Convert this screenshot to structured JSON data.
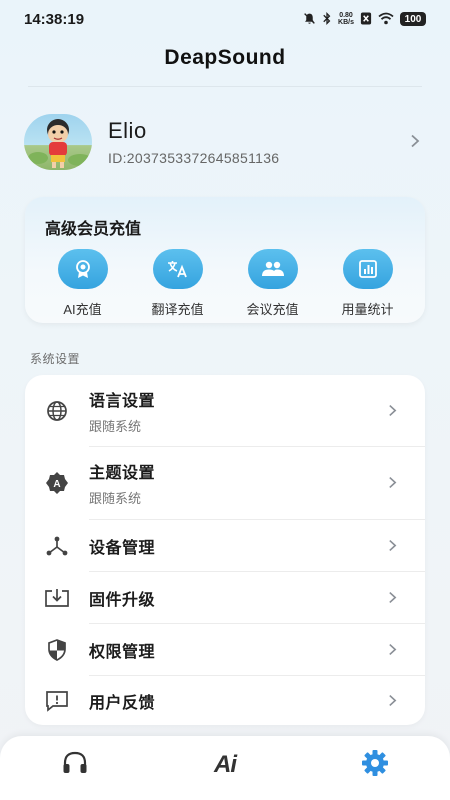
{
  "status_bar": {
    "time": "14:38:19",
    "net_speed_value": "0.80",
    "net_speed_unit": "KB/s",
    "battery": "100"
  },
  "app": {
    "title": "DeapSound"
  },
  "profile": {
    "name": "Elio",
    "id": "ID:2037353372645851136"
  },
  "vip": {
    "title": "高级会员充值",
    "items": [
      {
        "label": "AI充值",
        "icon": "ai-badge-icon"
      },
      {
        "label": "翻译充值",
        "icon": "translate-icon"
      },
      {
        "label": "会议充值",
        "icon": "meeting-people-icon"
      },
      {
        "label": "用量统计",
        "icon": "usage-chart-icon"
      }
    ]
  },
  "settings": {
    "section_title": "系统设置",
    "items": [
      {
        "label": "语言设置",
        "sub": "跟随系统",
        "icon": "globe-icon"
      },
      {
        "label": "主题设置",
        "sub": "跟随系统",
        "icon": "theme-icon"
      },
      {
        "label": "设备管理",
        "icon": "device-network-icon"
      },
      {
        "label": "固件升级",
        "icon": "firmware-download-icon"
      },
      {
        "label": "权限管理",
        "icon": "shield-icon"
      },
      {
        "label": "用户反馈",
        "icon": "feedback-icon"
      }
    ]
  },
  "bottom_nav": {
    "items": [
      {
        "icon": "headphones-icon",
        "active": false
      },
      {
        "icon": "ai-icon",
        "label": "Ai",
        "active": false
      },
      {
        "icon": "gear-icon",
        "active": true
      }
    ]
  },
  "colors": {
    "accent": "#2f8fe0",
    "vip_icon_bg": "#45afe6",
    "text_primary": "#1c1c1c",
    "text_secondary": "#777777"
  }
}
